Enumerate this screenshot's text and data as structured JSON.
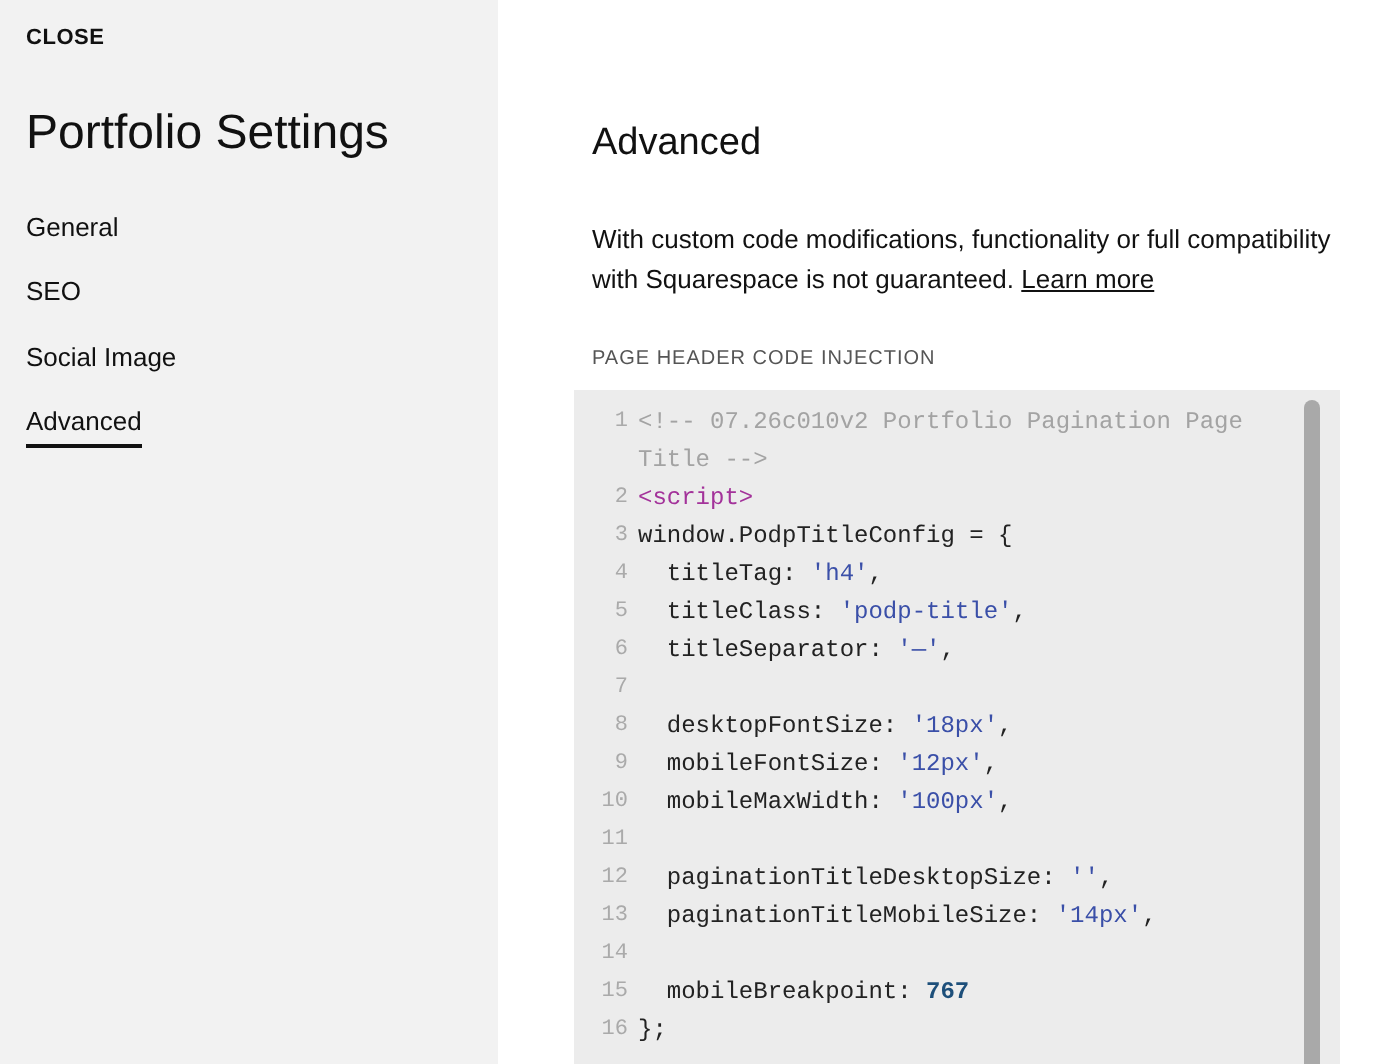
{
  "sidebar": {
    "close": "CLOSE",
    "title": "Portfolio Settings",
    "items": [
      {
        "label": "General",
        "selected": false
      },
      {
        "label": "SEO",
        "selected": false
      },
      {
        "label": "Social Image",
        "selected": false
      },
      {
        "label": "Advanced",
        "selected": true
      }
    ]
  },
  "main": {
    "heading": "Advanced",
    "description": "With custom code modifications, functionality or full compatibility with Squarespace is not guaranteed.",
    "link": "Learn more",
    "section_label": "PAGE HEADER CODE INJECTION",
    "code_lines": [
      {
        "number": "1",
        "tokens": [
          {
            "kind": "comment",
            "text": "<!-- 07.26c010v2 Portfolio Pagination Page Title -->"
          }
        ]
      },
      {
        "number": "2",
        "tokens": [
          {
            "kind": "tag",
            "text": "<script>"
          }
        ]
      },
      {
        "number": "3",
        "tokens": [
          {
            "kind": "plain",
            "text": "window.PodpTitleConfig = {"
          }
        ]
      },
      {
        "number": "4",
        "tokens": [
          {
            "kind": "plain",
            "text": "  titleTag: "
          },
          {
            "kind": "string",
            "text": "'h4'"
          },
          {
            "kind": "plain",
            "text": ","
          }
        ]
      },
      {
        "number": "5",
        "tokens": [
          {
            "kind": "plain",
            "text": "  titleClass: "
          },
          {
            "kind": "string",
            "text": "'podp-title'"
          },
          {
            "kind": "plain",
            "text": ","
          }
        ]
      },
      {
        "number": "6",
        "tokens": [
          {
            "kind": "plain",
            "text": "  titleSeparator: "
          },
          {
            "kind": "string",
            "text": "'—'"
          },
          {
            "kind": "plain",
            "text": ","
          }
        ]
      },
      {
        "number": "7"
      },
      {
        "number": "8",
        "tokens": [
          {
            "kind": "plain",
            "text": "  desktopFontSize: "
          },
          {
            "kind": "string",
            "text": "'18px'"
          },
          {
            "kind": "plain",
            "text": ","
          }
        ]
      },
      {
        "number": "9",
        "tokens": [
          {
            "kind": "plain",
            "text": "  mobileFontSize: "
          },
          {
            "kind": "string",
            "text": "'12px'"
          },
          {
            "kind": "plain",
            "text": ","
          }
        ]
      },
      {
        "number": "10",
        "tokens": [
          {
            "kind": "plain",
            "text": "  mobileMaxWidth: "
          },
          {
            "kind": "string",
            "text": "'100px'"
          },
          {
            "kind": "plain",
            "text": ","
          }
        ]
      },
      {
        "number": "11"
      },
      {
        "number": "12",
        "tokens": [
          {
            "kind": "plain",
            "text": "  paginationTitleDesktopSize: "
          },
          {
            "kind": "string",
            "text": "''"
          },
          {
            "kind": "plain",
            "text": ","
          }
        ]
      },
      {
        "number": "13",
        "tokens": [
          {
            "kind": "plain",
            "text": "  paginationTitleMobileSize: "
          },
          {
            "kind": "string",
            "text": "'14px'"
          },
          {
            "kind": "plain",
            "text": ","
          }
        ]
      },
      {
        "number": "14"
      },
      {
        "number": "15",
        "tokens": [
          {
            "kind": "plain",
            "text": "  mobileBreakpoint: "
          },
          {
            "kind": "number",
            "text": "767"
          }
        ]
      },
      {
        "number": "16",
        "tokens": [
          {
            "kind": "plain",
            "text": "};"
          }
        ]
      }
    ]
  }
}
